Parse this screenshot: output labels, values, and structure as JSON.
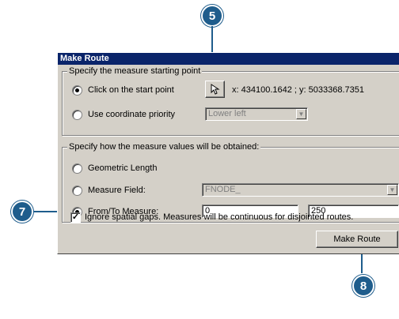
{
  "callouts": {
    "select_point": "5",
    "from_to": "7",
    "make_route": "8"
  },
  "dialog": {
    "title": "Make Route",
    "start_group": {
      "legend": "Specify the measure starting point",
      "click_label": "Click on the start point",
      "coordinates": "x: 434100.1642 ; y: 5033368.7351",
      "priority_label": "Use coordinate priority",
      "priority_value": "Lower left",
      "selected": "click"
    },
    "measure_group": {
      "legend": "Specify how the measure values will be obtained:",
      "geometric_label": "Geometric Length",
      "field_label": "Measure Field:",
      "field_value": "FNODE_",
      "fromto_label": "From/To Measure:",
      "from_value": "0",
      "to_value": "250",
      "selected": "fromto"
    },
    "ignore_gaps_label": "Ignore spatial gaps. Measures will be continuous for disjointed routes.",
    "ignore_gaps_checked": true,
    "make_route_label": "Make Route"
  },
  "colors": {
    "callout": "#1f5d8c",
    "titlebar": "#0a246a",
    "dialog_bg": "#d4d0c8"
  },
  "icons": {
    "select_point": "cursor-arrow-icon",
    "dropdown": "chevron-down-icon",
    "check": "check-icon"
  }
}
